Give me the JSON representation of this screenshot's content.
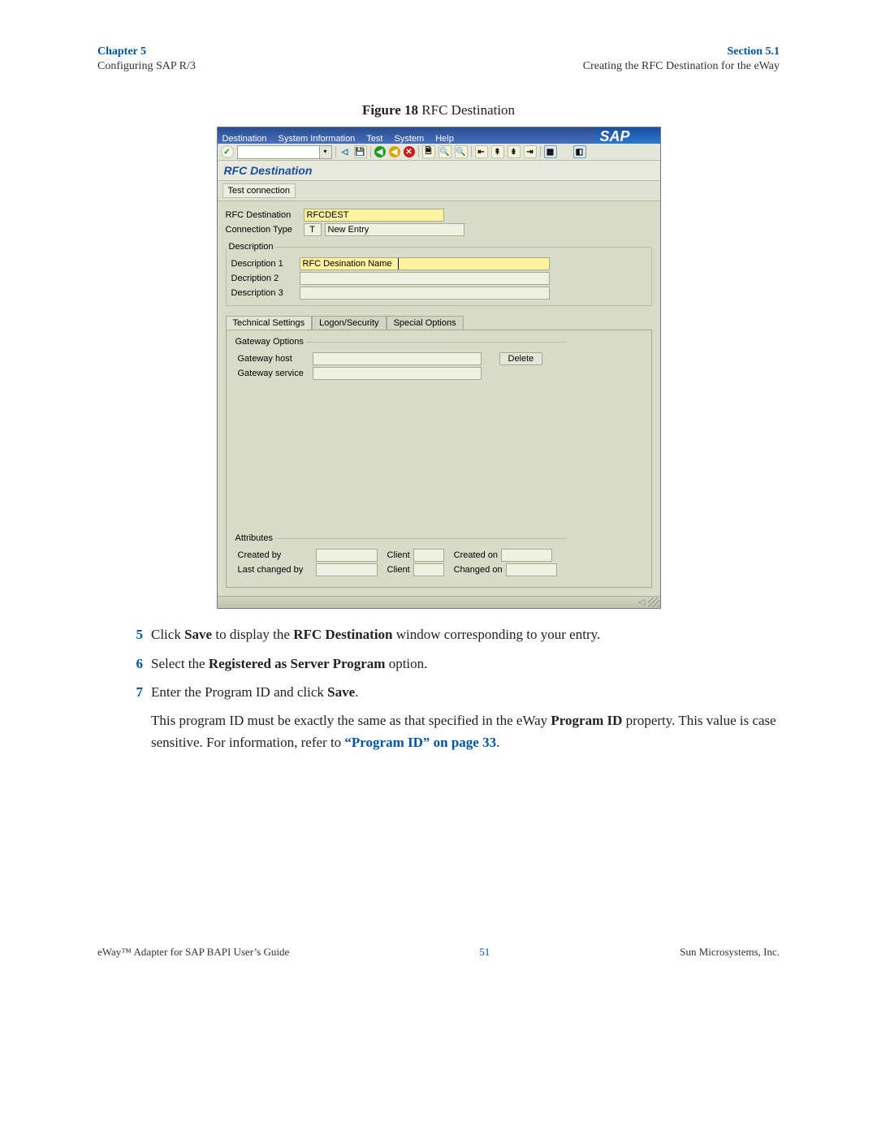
{
  "header": {
    "left_top": "Chapter 5",
    "left_bottom": "Configuring SAP R/3",
    "right_top": "Section 5.1",
    "right_bottom": "Creating the RFC Destination for the eWay"
  },
  "figure": {
    "label_bold": "Figure 18",
    "label_rest": "  RFC Destination"
  },
  "sap": {
    "menus": [
      "Destination",
      "System Information",
      "Test",
      "System",
      "Help"
    ],
    "logo": "SAP",
    "title": "RFC Destination",
    "test_conn": "Test connection",
    "labels": {
      "rfc_dest": "RFC Destination",
      "conn_type": "Connection Type",
      "conn_type_val": "T",
      "new_entry": "New Entry",
      "desc_group": "Description",
      "desc1": "Description 1",
      "desc2": "Decription 2",
      "desc3": "Description 3",
      "desc1_val": "RFC Desination Name",
      "rfc_dest_val": "RFCDEST"
    },
    "tabs": {
      "t1": "Technical Settings",
      "t2": "Logon/Security",
      "t3": "Special Options"
    },
    "gateway": {
      "group": "Gateway Options",
      "host": "Gateway host",
      "service": "Gateway service",
      "delete": "Delete"
    },
    "attrs": {
      "group": "Attributes",
      "created_by": "Created by",
      "last_changed": "Last changed by",
      "client": "Client",
      "created_on": "Created on",
      "changed_on": "Changed on"
    },
    "status_left_arrow": "◁"
  },
  "steps": {
    "s5_pre": "Click ",
    "s5_b1": "Save",
    "s5_mid": " to display the ",
    "s5_b2": "RFC Destination",
    "s5_post": " window corresponding to your entry.",
    "s6_pre": "Select the ",
    "s6_b": "Registered as Server Program",
    "s6_post": " option.",
    "s7_pre": "Enter the Program ID and click ",
    "s7_b": "Save",
    "s7_post": ".",
    "s7p_pre": "This program ID must be exactly the same as that specified in the eWay ",
    "s7p_b": "Program ID",
    "s7p_mid": " property. This value is case sensitive. For information, refer to ",
    "s7p_link": "“Program ID” on page 33",
    "s7p_post": "."
  },
  "numbers": {
    "n5": "5",
    "n6": "6",
    "n7": "7"
  },
  "footer": {
    "left": "eWay™ Adapter for SAP BAPI User’s Guide",
    "mid": "51",
    "right": "Sun Microsystems, Inc."
  }
}
